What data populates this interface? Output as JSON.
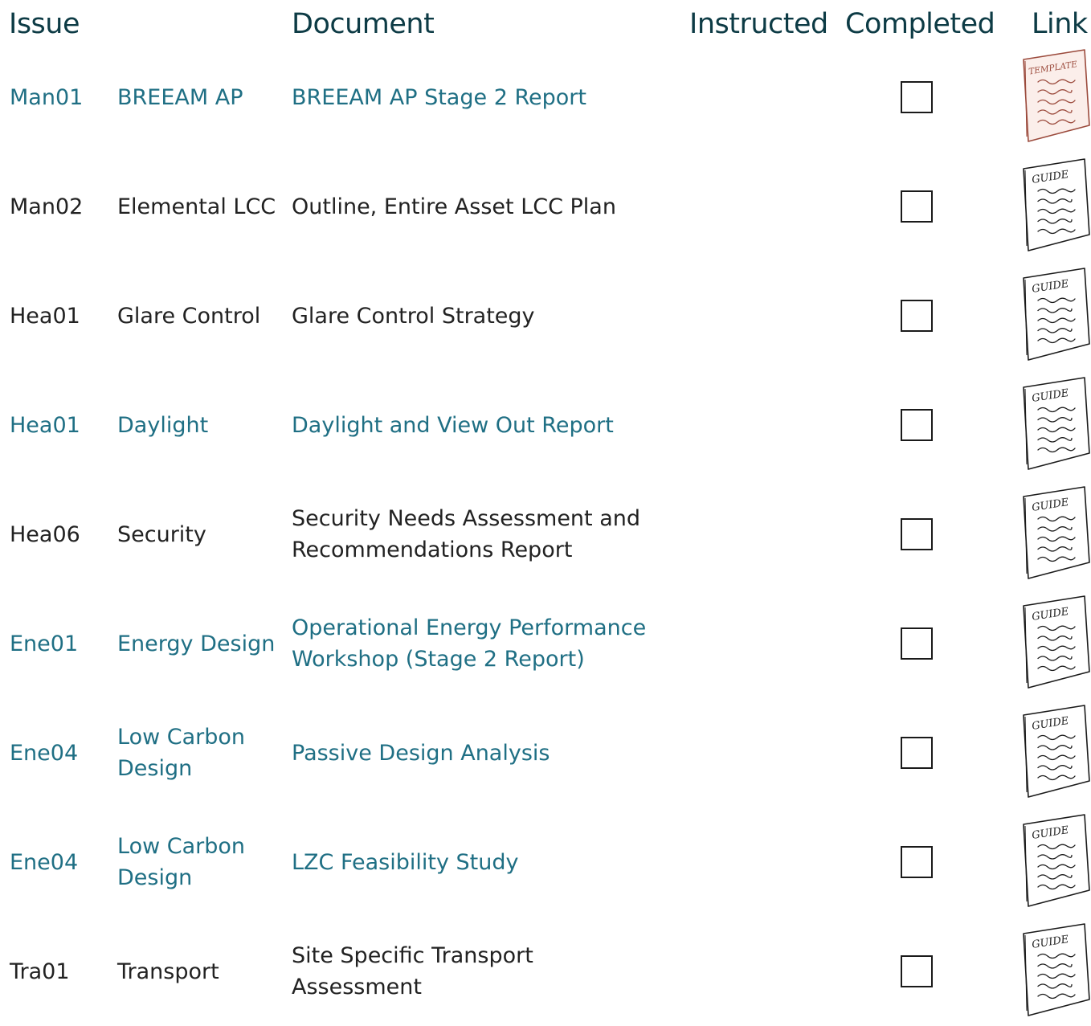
{
  "header": {
    "issue": "Issue",
    "document": "Document",
    "instructed": "Instructed",
    "completed": "Completed",
    "link": "Link"
  },
  "colors": {
    "header_text": "#0d3b45",
    "link_text": "#1f6f84",
    "plain_text": "#222222",
    "template_icon": "#9b4a3c",
    "guide_icon": "#1a1a1a"
  },
  "rows": [
    {
      "issue": "Man01",
      "topic": "BREEAM AP",
      "document": "BREEAM AP Stage 2 Report",
      "linked": true,
      "completed": false,
      "link_icon": "template-icon",
      "link_label": "TEMPLATE"
    },
    {
      "issue": "Man02",
      "topic": "Elemental LCC",
      "document": "Outline, Entire Asset LCC Plan",
      "linked": false,
      "completed": false,
      "link_icon": "guide-icon",
      "link_label": "GUIDE"
    },
    {
      "issue": "Hea01",
      "topic": "Glare Control",
      "document": "Glare Control Strategy",
      "linked": false,
      "completed": false,
      "link_icon": "guide-icon",
      "link_label": "GUIDE"
    },
    {
      "issue": "Hea01",
      "topic": "Daylight",
      "document": "Daylight and View Out Report",
      "linked": true,
      "completed": false,
      "link_icon": "guide-icon",
      "link_label": "GUIDE"
    },
    {
      "issue": "Hea06",
      "topic": "Security",
      "document": "Security Needs Assessment and Recommendations Report",
      "linked": false,
      "completed": false,
      "link_icon": "guide-icon",
      "link_label": "GUIDE"
    },
    {
      "issue": "Ene01",
      "topic": "Energy Design",
      "document": "Operational Energy Performance Workshop (Stage 2 Report)",
      "linked": true,
      "completed": false,
      "link_icon": "guide-icon",
      "link_label": "GUIDE"
    },
    {
      "issue": "Ene04",
      "topic": "Low Carbon Design",
      "document": "Passive Design Analysis",
      "linked": true,
      "completed": false,
      "link_icon": "guide-icon",
      "link_label": "GUIDE"
    },
    {
      "issue": "Ene04",
      "topic": "Low Carbon Design",
      "document": "LZC Feasibility Study",
      "linked": true,
      "completed": false,
      "link_icon": "guide-icon",
      "link_label": "GUIDE"
    },
    {
      "issue": "Tra01",
      "topic": "Transport",
      "document": "Site Specific Transport Assessment",
      "linked": false,
      "completed": false,
      "link_icon": "guide-icon",
      "link_label": "GUIDE"
    }
  ]
}
